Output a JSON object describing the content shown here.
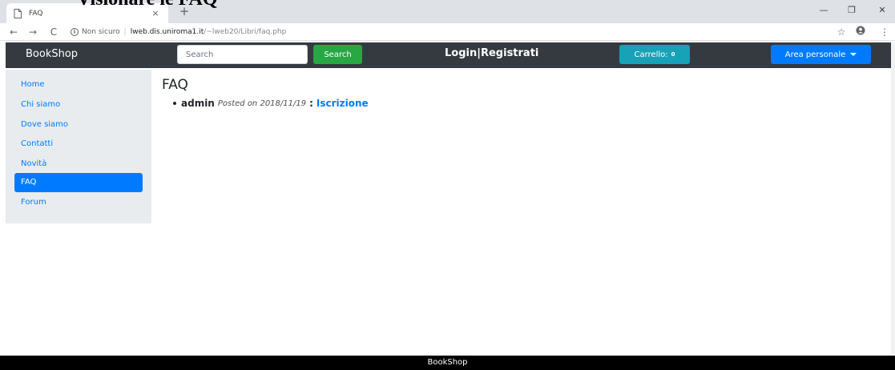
{
  "doc_heading": "Visionare le FAQ",
  "browser": {
    "tab_title": "FAQ",
    "tab_close": "×",
    "new_tab": "+",
    "win_minimize": "—",
    "win_restore": "❐",
    "win_close": "✕",
    "back": "←",
    "forward": "→",
    "reload": "C",
    "security_label": "Non sicuro",
    "url_host": "lweb.dis.uniroma1.it",
    "url_path": "/~lweb20/Libri/faq.php",
    "star": "☆",
    "menu": "⋮"
  },
  "navbar": {
    "brand": "BookShop",
    "search_placeholder": "Search",
    "search_button": "Search",
    "login": "Login|Registrati",
    "cart_label": "Carrello:",
    "cart_count": "0",
    "area_personale": "Area personale"
  },
  "sidebar": {
    "items": [
      {
        "label": "Home",
        "active": false
      },
      {
        "label": "Chi siamo",
        "active": false
      },
      {
        "label": "Dove siamo",
        "active": false
      },
      {
        "label": "Contatti",
        "active": false
      },
      {
        "label": "Novità",
        "active": false
      },
      {
        "label": "FAQ",
        "active": true
      },
      {
        "label": "Forum",
        "active": false
      }
    ]
  },
  "main": {
    "title": "FAQ",
    "faqs": [
      {
        "author": "admin",
        "posted": "Posted on 2018/11/19",
        "separator": ":",
        "subject": "Iscrizione"
      }
    ]
  },
  "footer": {
    "text": "BookShop"
  },
  "colors": {
    "navbar_bg": "#343a40",
    "primary": "#007bff",
    "success": "#28a745",
    "info": "#17a2b8",
    "footer_bg": "#000000"
  }
}
